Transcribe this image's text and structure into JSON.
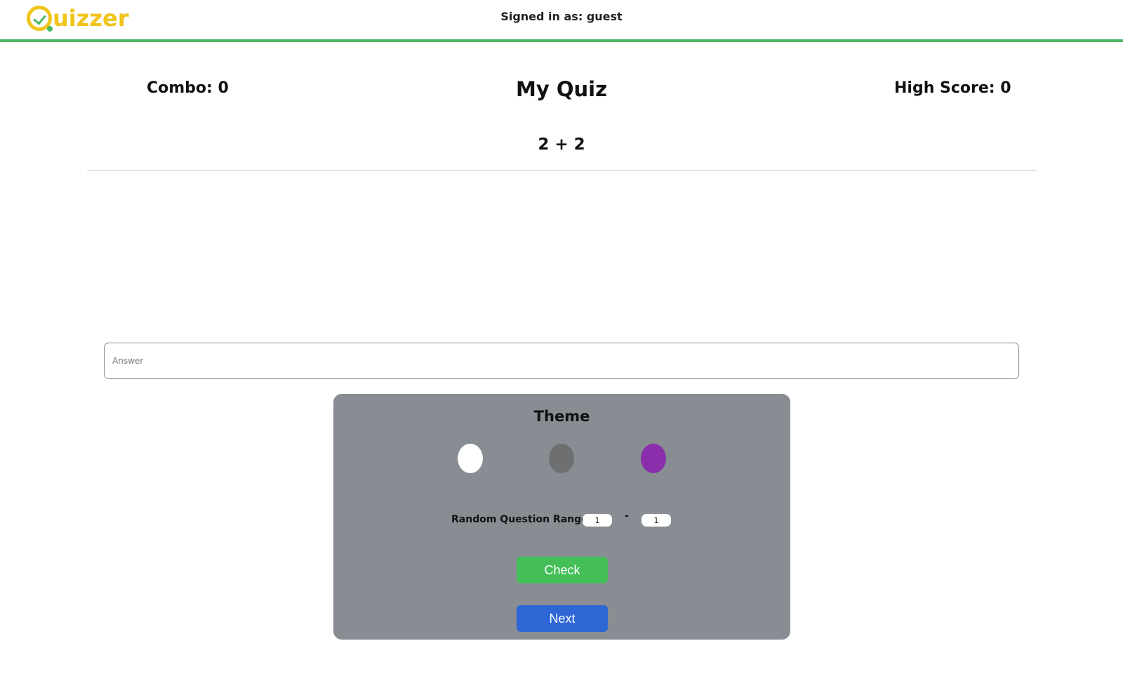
{
  "header": {
    "logo_text": "uizzer",
    "signed_in": "Signed in as: guest"
  },
  "quiz": {
    "combo": "Combo: 0",
    "title": "My Quiz",
    "high_score": "High Score: 0",
    "question": "2 + 2"
  },
  "answer": {
    "placeholder": "Answer",
    "value": ""
  },
  "panel": {
    "title": "Theme",
    "themes": [
      {
        "name": "white",
        "color": "#ffffff"
      },
      {
        "name": "gray",
        "color": "#6e6f70"
      },
      {
        "name": "purple",
        "color": "#8b2eab"
      }
    ],
    "range_label": "Random Question Range",
    "range_from": "1",
    "range_separator": "-",
    "range_to": "1",
    "check_label": "Check",
    "next_label": "Next"
  },
  "colors": {
    "accent_green": "#4ab862",
    "logo_yellow": "#f0c419",
    "panel_bg": "#878d93",
    "check_button": "#44bf58",
    "next_button": "#2e66d6"
  }
}
